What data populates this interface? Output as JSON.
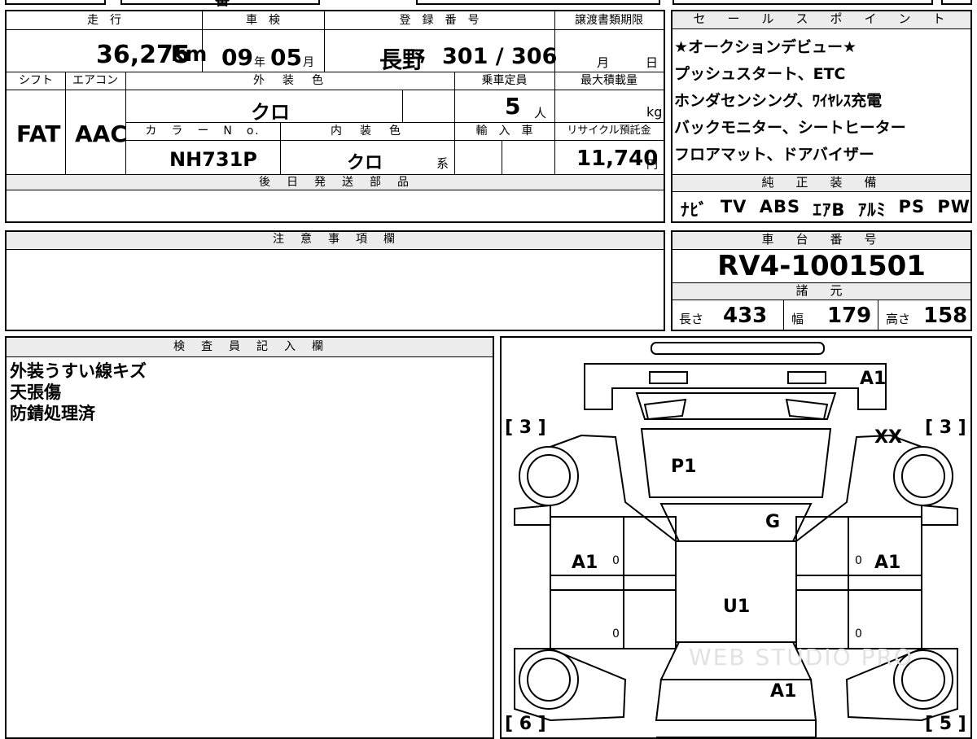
{
  "top_strip": {
    "text": "番"
  },
  "headers": {
    "mileage": "走　行",
    "inspection": "車　検",
    "registration": "登　録　番　号",
    "transfer_deadline": "譲渡書類期限",
    "shift": "シフト",
    "aircon": "エアコン",
    "exterior_color": "外　装　色",
    "capacity": "乗車定員",
    "max_load": "最大積載量",
    "color_no": "カ　ラ　ー　N　o.",
    "interior_color": "内　装　色",
    "import": "輸　入　車",
    "recycle": "リサイクル預託金",
    "later_parts": "後　日　発　送　部　品",
    "sales_points": "セ　ー　ル　ス　ポ　イ　ン　ト",
    "genuine_equipment": "純　正　装　備",
    "notes": "注　意　事　項　欄",
    "chassis_no": "車　台　番　号",
    "specs": "諸　元",
    "inspector": "検　査　員　記　入　欄"
  },
  "vehicle": {
    "mileage": "36,275",
    "mileage_unit": "km",
    "inspection_year": "09",
    "year_unit": "年",
    "inspection_month": "05",
    "month_unit": "月",
    "reg_area": "長野",
    "reg_number": "301 / 306",
    "deadline_month_unit": "月",
    "deadline_day_unit": "日",
    "shift": "FAT",
    "aircon": "AAC",
    "exterior_color": "クロ",
    "capacity": "5",
    "capacity_unit": "人",
    "max_load_unit": "kg",
    "color_no": "NH731P",
    "interior_color": "クロ",
    "interior_suffix": "系",
    "recycle_fee": "11,740",
    "recycle_unit": "円",
    "chassis_no": "RV4-1001501"
  },
  "sales_points": [
    "★オークションデビュー★",
    "プッシュスタート、ETC",
    "ホンダセンシング、ﾜｲﾔﾚｽ充電",
    "バックモニター、シートヒーター",
    "フロアマット、ドアバイザー"
  ],
  "equipment": [
    "ﾅﾋﾞ",
    "TV",
    "ABS",
    "ｴｱB",
    "ｱﾙﾐ",
    "PS",
    "PW"
  ],
  "specs": {
    "length_label": "長さ",
    "length": "433",
    "width_label": "幅",
    "width": "179",
    "height_label": "高さ",
    "height": "158"
  },
  "inspector_notes": [
    "外装うすい線キズ",
    "天張傷",
    "防錆処理済"
  ],
  "diagram": {
    "labels": {
      "front_bumper": "A1",
      "front_right_corner": "XX",
      "hood": "P1",
      "windshield": "G",
      "left_front_door": "A1",
      "right_front_door": "A1",
      "roof": "U1",
      "rear": "A1"
    },
    "tire_marks": {
      "fl": "[ 3 ]",
      "fr": "[ 3 ]",
      "rl": "[ 6 ]",
      "rr": "[ 5 ]"
    },
    "zeros": [
      "0",
      "0",
      "0",
      "0"
    ],
    "watermark": "WEB STUDIO PRO"
  }
}
